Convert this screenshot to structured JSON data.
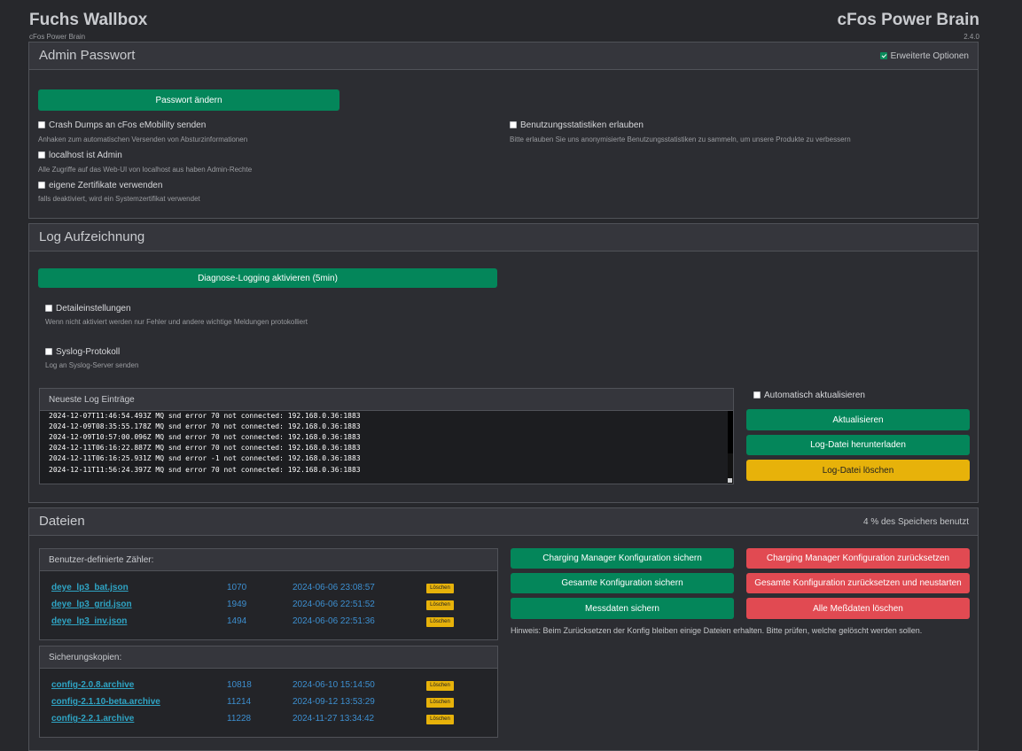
{
  "header": {
    "title": "Fuchs Wallbox",
    "subtitle": "cFos Power Brain",
    "brand": "cFos Power Brain",
    "version": "2.4.0"
  },
  "admin": {
    "title": "Admin Passwort",
    "advanced_options_label": "Erweiterte Optionen",
    "advanced_options_checked": true,
    "change_password_label": "Passwort ändern",
    "options": [
      {
        "label": "Crash Dumps an cFos eMobility senden",
        "help": "Anhaken zum automatischen Versenden von Absturzinformationen",
        "checked": false
      },
      {
        "label": "localhost ist Admin",
        "help": "Alle Zugriffe auf das Web-UI von localhost aus haben Admin-Rechte",
        "checked": false
      },
      {
        "label": "eigene Zertifikate verwenden",
        "help": "falls deaktiviert, wird ein Systemzertifikat verwendet",
        "checked": false
      },
      {
        "label": "Benutzungsstatistiken erlauben",
        "help": "Bitte erlauben Sie uns anonymisierte Benutzungsstatistiken zu sammeln, um unsere Produkte zu verbessern",
        "checked": false
      }
    ]
  },
  "log": {
    "title": "Log Aufzeichnung",
    "diag_button_label": "Diagnose-Logging aktivieren (5min)",
    "detail": {
      "label": "Detaileinstellungen",
      "help": "Wenn nicht aktiviert werden nur Fehler und andere wichtige Meldungen protokolliert",
      "checked": false
    },
    "syslog": {
      "label": "Syslog-Protokoll",
      "help": "Log an Syslog-Server senden",
      "checked": false
    },
    "entries_title": "Neueste Log Einträge",
    "entries": [
      "2024-12-07T11:46:54.493Z MQ snd error 70 not connected: 192.168.0.36:1883",
      "2024-12-09T08:35:55.178Z MQ snd error 70 not connected: 192.168.0.36:1883",
      "2024-12-09T10:57:00.096Z MQ snd error 70 not connected: 192.168.0.36:1883",
      "2024-12-11T06:16:22.887Z MQ snd error 70 not connected: 192.168.0.36:1883",
      "2024-12-11T06:16:25.931Z MQ snd error -1 not connected: 192.168.0.36:1883",
      "2024-12-11T11:56:24.397Z MQ snd error 70 not connected: 192.168.0.36:1883"
    ],
    "auto_refresh_label": "Automatisch aktualisieren",
    "auto_refresh_checked": false,
    "refresh_label": "Aktualisieren",
    "download_label": "Log-Datei herunterladen",
    "delete_label": "Log-Datei löschen"
  },
  "files": {
    "title": "Dateien",
    "storage_info": "4 % des Speichers benutzt",
    "delete_label": "Löschen",
    "counters": {
      "title": "Benutzer-definierte Zähler:",
      "rows": [
        {
          "name": "deye_lp3_bat.json",
          "size": "1070",
          "date": "2024-06-06 23:08:57"
        },
        {
          "name": "deye_lp3_grid.json",
          "size": "1949",
          "date": "2024-06-06 22:51:52"
        },
        {
          "name": "deye_lp3_inv.json",
          "size": "1494",
          "date": "2024-06-06 22:51:36"
        }
      ]
    },
    "backups": {
      "title": "Sicherungskopien:",
      "rows": [
        {
          "name": "config-2.0.8.archive",
          "size": "10818",
          "date": "2024-06-10 15:14:50"
        },
        {
          "name": "config-2.1.10-beta.archive",
          "size": "11214",
          "date": "2024-09-12 13:53:29"
        },
        {
          "name": "config-2.2.1.archive",
          "size": "11228",
          "date": "2024-11-27 13:34:42"
        }
      ]
    },
    "save_cm_label": "Charging Manager Konfiguration sichern",
    "save_all_label": "Gesamte Konfiguration sichern",
    "save_meas_label": "Messdaten sichern",
    "reset_cm_label": "Charging Manager Konfiguration zurücksetzen",
    "reset_all_label": "Gesamte Konfiguration zurücksetzen und neustarten",
    "delete_meas_label": "Alle Meßdaten löschen",
    "hint": "Hinweis: Beim Zurücksetzen der Konfig bleiben einige Dateien erhalten. Bitte prüfen, welche gelöscht werden sollen."
  },
  "colors": {
    "accent_green": "#04865a",
    "warn_yellow": "#e7b20a",
    "danger_red": "#e14a52",
    "link": "#2fa4c4"
  }
}
